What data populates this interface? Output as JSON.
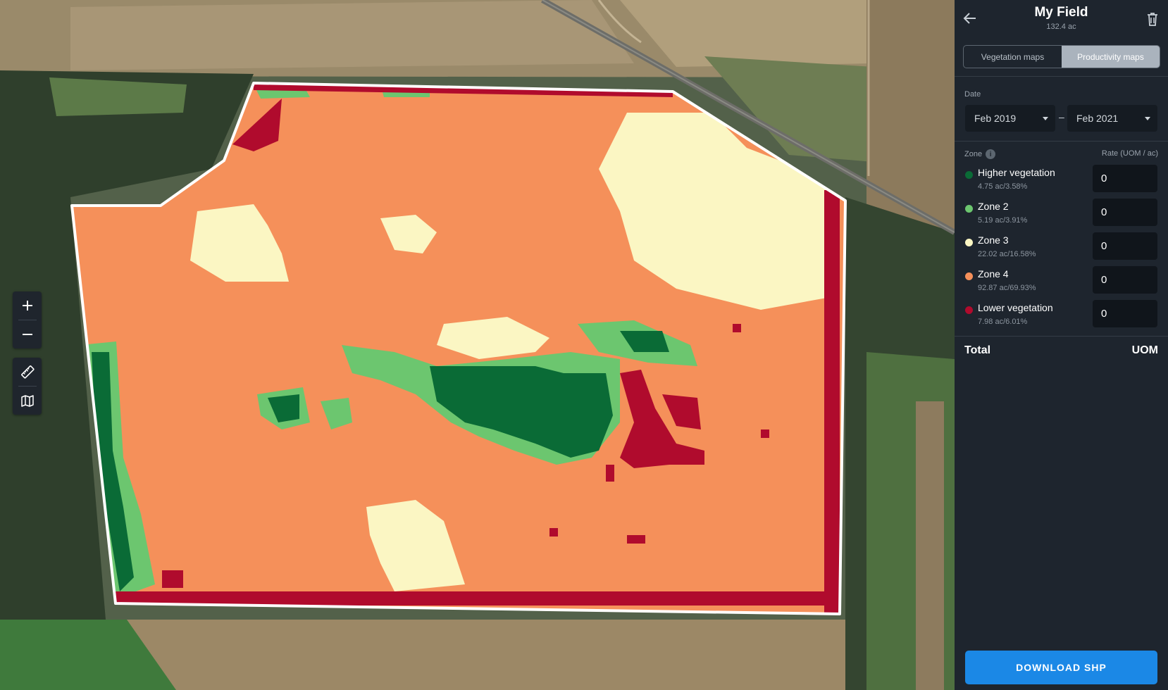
{
  "panel": {
    "title": "My Field",
    "area": "132.4 ac",
    "tabs": [
      {
        "label": "Vegetation maps",
        "active": false
      },
      {
        "label": "Productivity maps",
        "active": true
      }
    ],
    "date": {
      "label": "Date",
      "from": "Feb 2019",
      "separator": "–",
      "to": "Feb 2021"
    },
    "zone_header": "Zone",
    "info_icon": "i",
    "rate_header": "Rate (UOM / ac)",
    "zones": [
      {
        "name": "Higher vegetation",
        "stat": "4.75 ac/3.58%",
        "rate": "0",
        "color": "#0a6b36"
      },
      {
        "name": "Zone 2",
        "stat": "5.19 ac/3.91%",
        "rate": "0",
        "color": "#6cc66f"
      },
      {
        "name": "Zone 3",
        "stat": "22.02 ac/16.58%",
        "rate": "0",
        "color": "#fbf6c3"
      },
      {
        "name": "Zone 4",
        "stat": "92.87 ac/69.93%",
        "rate": "0",
        "color": "#f5905a"
      },
      {
        "name": "Lower vegetation",
        "stat": "7.98 ac/6.01%",
        "rate": "0",
        "color": "#b00b2d"
      }
    ],
    "total_label": "Total",
    "total_uom": "UOM",
    "download_label": "DOWNLOAD SHP"
  },
  "map_tools": {
    "icons": [
      "zoom-in-icon",
      "zoom-out-icon",
      "ruler-icon",
      "map-layers-icon"
    ]
  },
  "colors": {
    "panel_bg": "#1e252e",
    "accent": "#1b88e6",
    "zone_high": "#0a6b36",
    "zone_2": "#6cc66f",
    "zone_3": "#fbf6c3",
    "zone_4": "#f5905a",
    "zone_low": "#b00b2d"
  }
}
